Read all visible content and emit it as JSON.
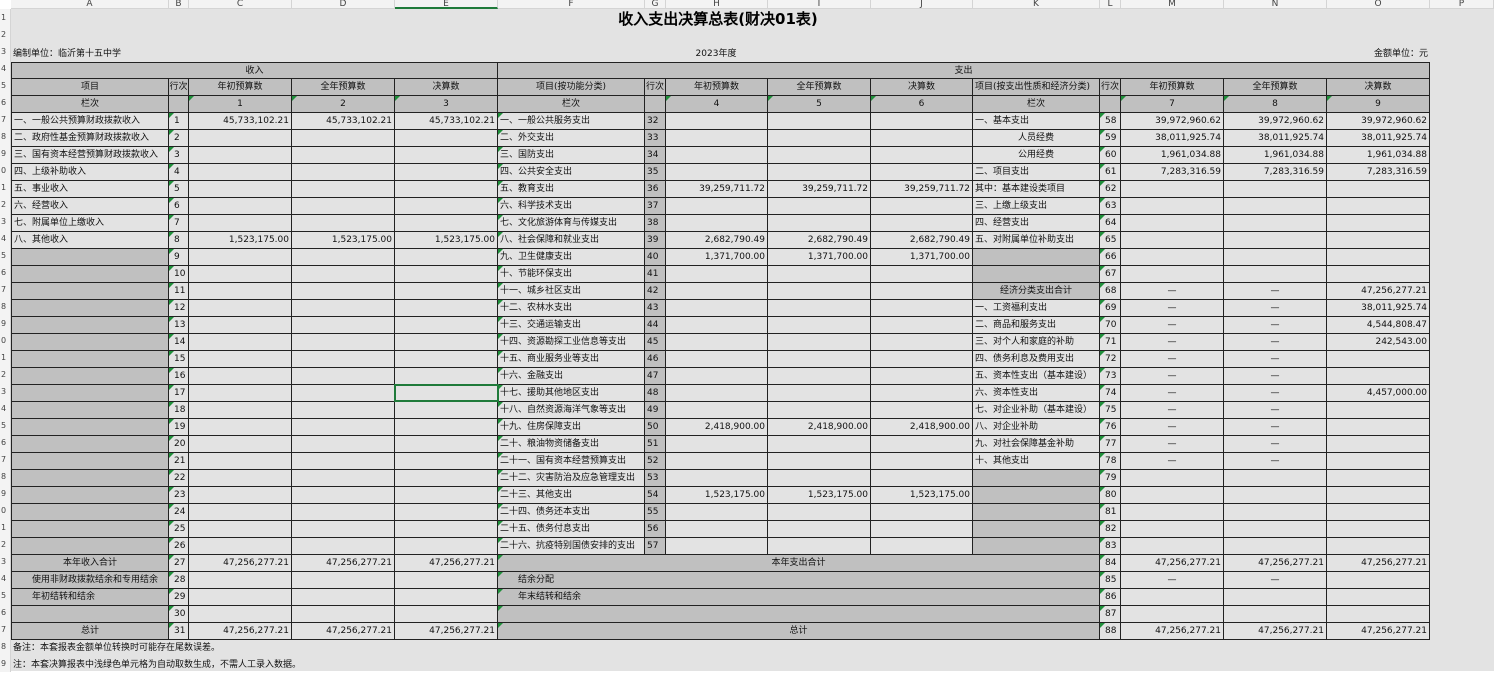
{
  "sheet": {
    "columns": [
      "A",
      "B",
      "C",
      "D",
      "E",
      "F",
      "G",
      "H",
      "I",
      "J",
      "K",
      "L",
      "M",
      "N",
      "O",
      "P"
    ],
    "row_numbers": [
      "1",
      "2",
      "3",
      "4",
      "5",
      "6",
      "7",
      "8",
      "9",
      "0",
      "1",
      "2",
      "3",
      "4",
      "5",
      "6",
      "7",
      "8",
      "9",
      "0",
      "1",
      "2",
      "3",
      "4",
      "5",
      "6",
      "7",
      "8",
      "9",
      "0",
      "1",
      "2",
      "3",
      "4",
      "5",
      "6",
      "7",
      "8",
      "9"
    ]
  },
  "report": {
    "title": "收入支出决算总表(财决01表)",
    "unit_label": "编制单位：临沂第十五中学",
    "year": "2023年度",
    "amount_unit": "金额单位：元",
    "income_header": "收入",
    "expense_header": "支出",
    "col_item": "项目",
    "col_row": "行次",
    "col_initial": "年初预算数",
    "col_full": "全年预算数",
    "col_final": "决算数",
    "col_func": "项目(按功能分类)",
    "col_econ": "项目(按支出性质和经济分类)",
    "col_colnum": "栏次",
    "colnums_income": [
      "1",
      "2",
      "3"
    ],
    "colnums_func": [
      "4",
      "5",
      "6"
    ],
    "colnums_econ": [
      "7",
      "8",
      "9"
    ],
    "note1": "备注：本套报表金额单位转换时可能存在尾数误差。",
    "note2": "注：本套决算报表中浅绿色单元格为自动取数生成，不需人工录入数据。"
  },
  "rows": [
    {
      "inc": "一、一般公共预算财政拨款收入",
      "r1": "1",
      "i1": "45,733,102.21",
      "i2": "45,733,102.21",
      "i3": "45,733,102.21",
      "func": "一、一般公共服务支出",
      "r2": "32",
      "f1": "",
      "f2": "",
      "f3": "",
      "econ": "一、基本支出",
      "r3": "58",
      "e1": "39,972,960.62",
      "e2": "39,972,960.62",
      "e3": "39,972,960.62"
    },
    {
      "inc": "二、政府性基金预算财政拨款收入",
      "r1": "2",
      "i1": "",
      "i2": "",
      "i3": "",
      "func": "二、外交支出",
      "r2": "33",
      "f1": "",
      "f2": "",
      "f3": "",
      "econ": "人员经费",
      "r3": "59",
      "e1": "38,011,925.74",
      "e2": "38,011,925.74",
      "e3": "38,011,925.74"
    },
    {
      "inc": "三、国有资本经营预算财政拨款收入",
      "r1": "3",
      "i1": "",
      "i2": "",
      "i3": "",
      "func": "三、国防支出",
      "r2": "34",
      "f1": "",
      "f2": "",
      "f3": "",
      "econ": "公用经费",
      "r3": "60",
      "e1": "1,961,034.88",
      "e2": "1,961,034.88",
      "e3": "1,961,034.88"
    },
    {
      "inc": "四、上级补助收入",
      "r1": "4",
      "i1": "",
      "i2": "",
      "i3": "",
      "func": "四、公共安全支出",
      "r2": "35",
      "f1": "",
      "f2": "",
      "f3": "",
      "econ": "二、项目支出",
      "r3": "61",
      "e1": "7,283,316.59",
      "e2": "7,283,316.59",
      "e3": "7,283,316.59"
    },
    {
      "inc": "五、事业收入",
      "r1": "5",
      "i1": "",
      "i2": "",
      "i3": "",
      "func": "五、教育支出",
      "r2": "36",
      "f1": "39,259,711.72",
      "f2": "39,259,711.72",
      "f3": "39,259,711.72",
      "econ": "其中：基本建设类项目",
      "r3": "62",
      "e1": "",
      "e2": "",
      "e3": ""
    },
    {
      "inc": "六、经营收入",
      "r1": "6",
      "i1": "",
      "i2": "",
      "i3": "",
      "func": "六、科学技术支出",
      "r2": "37",
      "f1": "",
      "f2": "",
      "f3": "",
      "econ": "三、上缴上级支出",
      "r3": "63",
      "e1": "",
      "e2": "",
      "e3": ""
    },
    {
      "inc": "七、附属单位上缴收入",
      "r1": "7",
      "i1": "",
      "i2": "",
      "i3": "",
      "func": "七、文化旅游体育与传媒支出",
      "r2": "38",
      "f1": "",
      "f2": "",
      "f3": "",
      "econ": "四、经营支出",
      "r3": "64",
      "e1": "",
      "e2": "",
      "e3": ""
    },
    {
      "inc": "八、其他收入",
      "r1": "8",
      "i1": "1,523,175.00",
      "i2": "1,523,175.00",
      "i3": "1,523,175.00",
      "func": "八、社会保障和就业支出",
      "r2": "39",
      "f1": "2,682,790.49",
      "f2": "2,682,790.49",
      "f3": "2,682,790.49",
      "econ": "五、对附属单位补助支出",
      "r3": "65",
      "e1": "",
      "e2": "",
      "e3": ""
    },
    {
      "inc": "",
      "r1": "9",
      "i1": "",
      "i2": "",
      "i3": "",
      "func": "九、卫生健康支出",
      "r2": "40",
      "f1": "1,371,700.00",
      "f2": "1,371,700.00",
      "f3": "1,371,700.00",
      "econ": "",
      "r3": "66",
      "e1": "",
      "e2": "",
      "e3": ""
    },
    {
      "inc": "",
      "r1": "10",
      "i1": "",
      "i2": "",
      "i3": "",
      "func": "十、节能环保支出",
      "r2": "41",
      "f1": "",
      "f2": "",
      "f3": "",
      "econ": "",
      "r3": "67",
      "e1": "",
      "e2": "",
      "e3": ""
    },
    {
      "inc": "",
      "r1": "11",
      "i1": "",
      "i2": "",
      "i3": "",
      "func": "十一、城乡社区支出",
      "r2": "42",
      "f1": "",
      "f2": "",
      "f3": "",
      "econ": "经济分类支出合计",
      "r3": "68",
      "e1": "—",
      "e2": "—",
      "e3": "47,256,277.21"
    },
    {
      "inc": "",
      "r1": "12",
      "i1": "",
      "i2": "",
      "i3": "",
      "func": "十二、农林水支出",
      "r2": "43",
      "f1": "",
      "f2": "",
      "f3": "",
      "econ": "一、工资福利支出",
      "r3": "69",
      "e1": "—",
      "e2": "—",
      "e3": "38,011,925.74"
    },
    {
      "inc": "",
      "r1": "13",
      "i1": "",
      "i2": "",
      "i3": "",
      "func": "十三、交通运输支出",
      "r2": "44",
      "f1": "",
      "f2": "",
      "f3": "",
      "econ": "二、商品和服务支出",
      "r3": "70",
      "e1": "—",
      "e2": "—",
      "e3": "4,544,808.47"
    },
    {
      "inc": "",
      "r1": "14",
      "i1": "",
      "i2": "",
      "i3": "",
      "func": "十四、资源勘探工业信息等支出",
      "r2": "45",
      "f1": "",
      "f2": "",
      "f3": "",
      "econ": "三、对个人和家庭的补助",
      "r3": "71",
      "e1": "—",
      "e2": "—",
      "e3": "242,543.00"
    },
    {
      "inc": "",
      "r1": "15",
      "i1": "",
      "i2": "",
      "i3": "",
      "func": "十五、商业服务业等支出",
      "r2": "46",
      "f1": "",
      "f2": "",
      "f3": "",
      "econ": "四、债务利息及费用支出",
      "r3": "72",
      "e1": "—",
      "e2": "—",
      "e3": ""
    },
    {
      "inc": "",
      "r1": "16",
      "i1": "",
      "i2": "",
      "i3": "",
      "func": "十六、金融支出",
      "r2": "47",
      "f1": "",
      "f2": "",
      "f3": "",
      "econ": "五、资本性支出（基本建设）",
      "r3": "73",
      "e1": "—",
      "e2": "—",
      "e3": ""
    },
    {
      "inc": "",
      "r1": "17",
      "i1": "",
      "i2": "",
      "i3": "",
      "func": "十七、援助其他地区支出",
      "r2": "48",
      "f1": "",
      "f2": "",
      "f3": "",
      "econ": "六、资本性支出",
      "r3": "74",
      "e1": "—",
      "e2": "—",
      "e3": "4,457,000.00"
    },
    {
      "inc": "",
      "r1": "18",
      "i1": "",
      "i2": "",
      "i3": "",
      "func": "十八、自然资源海洋气象等支出",
      "r2": "49",
      "f1": "",
      "f2": "",
      "f3": "",
      "econ": "七、对企业补助（基本建设）",
      "r3": "75",
      "e1": "—",
      "e2": "—",
      "e3": ""
    },
    {
      "inc": "",
      "r1": "19",
      "i1": "",
      "i2": "",
      "i3": "",
      "func": "十九、住房保障支出",
      "r2": "50",
      "f1": "2,418,900.00",
      "f2": "2,418,900.00",
      "f3": "2,418,900.00",
      "econ": "八、对企业补助",
      "r3": "76",
      "e1": "—",
      "e2": "—",
      "e3": ""
    },
    {
      "inc": "",
      "r1": "20",
      "i1": "",
      "i2": "",
      "i3": "",
      "func": "二十、粮油物资储备支出",
      "r2": "51",
      "f1": "",
      "f2": "",
      "f3": "",
      "econ": "九、对社会保障基金补助",
      "r3": "77",
      "e1": "—",
      "e2": "—",
      "e3": ""
    },
    {
      "inc": "",
      "r1": "21",
      "i1": "",
      "i2": "",
      "i3": "",
      "func": "二十一、国有资本经营预算支出",
      "r2": "52",
      "f1": "",
      "f2": "",
      "f3": "",
      "econ": "十、其他支出",
      "r3": "78",
      "e1": "—",
      "e2": "—",
      "e3": ""
    },
    {
      "inc": "",
      "r1": "22",
      "i1": "",
      "i2": "",
      "i3": "",
      "func": "二十二、灾害防治及应急管理支出",
      "r2": "53",
      "f1": "",
      "f2": "",
      "f3": "",
      "econ": "",
      "r3": "79",
      "e1": "",
      "e2": "",
      "e3": ""
    },
    {
      "inc": "",
      "r1": "23",
      "i1": "",
      "i2": "",
      "i3": "",
      "func": "二十三、其他支出",
      "r2": "54",
      "f1": "1,523,175.00",
      "f2": "1,523,175.00",
      "f3": "1,523,175.00",
      "econ": "",
      "r3": "80",
      "e1": "",
      "e2": "",
      "e3": ""
    },
    {
      "inc": "",
      "r1": "24",
      "i1": "",
      "i2": "",
      "i3": "",
      "func": "二十四、债务还本支出",
      "r2": "55",
      "f1": "",
      "f2": "",
      "f3": "",
      "econ": "",
      "r3": "81",
      "e1": "",
      "e2": "",
      "e3": ""
    },
    {
      "inc": "",
      "r1": "25",
      "i1": "",
      "i2": "",
      "i3": "",
      "func": "二十五、债务付息支出",
      "r2": "56",
      "f1": "",
      "f2": "",
      "f3": "",
      "econ": "",
      "r3": "82",
      "e1": "",
      "e2": "",
      "e3": ""
    },
    {
      "inc": "",
      "r1": "26",
      "i1": "",
      "i2": "",
      "i3": "",
      "func": "二十六、抗疫特别国债安排的支出",
      "r2": "57",
      "f1": "",
      "f2": "",
      "f3": "",
      "econ": "",
      "r3": "83",
      "e1": "",
      "e2": "",
      "e3": ""
    }
  ],
  "totals": [
    {
      "left": "本年收入合计",
      "r1": "27",
      "i1": "47,256,277.21",
      "i2": "47,256,277.21",
      "i3": "47,256,277.21",
      "right": "本年支出合计",
      "r3": "84",
      "e1": "47,256,277.21",
      "e2": "47,256,277.21",
      "e3": "47,256,277.21"
    },
    {
      "left": "使用非财政拨款结余和专用结余",
      "r1": "28",
      "i1": "",
      "i2": "",
      "i3": "",
      "right": "结余分配",
      "r3": "85",
      "e1": "—",
      "e2": "—",
      "e3": ""
    },
    {
      "left": "年初结转和结余",
      "r1": "29",
      "i1": "",
      "i2": "",
      "i3": "",
      "right": "年末结转和结余",
      "r3": "86",
      "e1": "",
      "e2": "",
      "e3": ""
    },
    {
      "left": "",
      "r1": "30",
      "i1": "",
      "i2": "",
      "i3": "",
      "right": "",
      "r3": "87",
      "e1": "",
      "e2": "",
      "e3": ""
    },
    {
      "left": "总计",
      "r1": "31",
      "i1": "47,256,277.21",
      "i2": "47,256,277.21",
      "i3": "47,256,277.21",
      "right": "总计",
      "r3": "88",
      "e1": "47,256,277.21",
      "e2": "47,256,277.21",
      "e3": "47,256,277.21"
    }
  ],
  "colors": {
    "gray_cell": "#c0c0c0",
    "green_marker": "#1f8f3a",
    "selection": "#1f7a3a"
  }
}
